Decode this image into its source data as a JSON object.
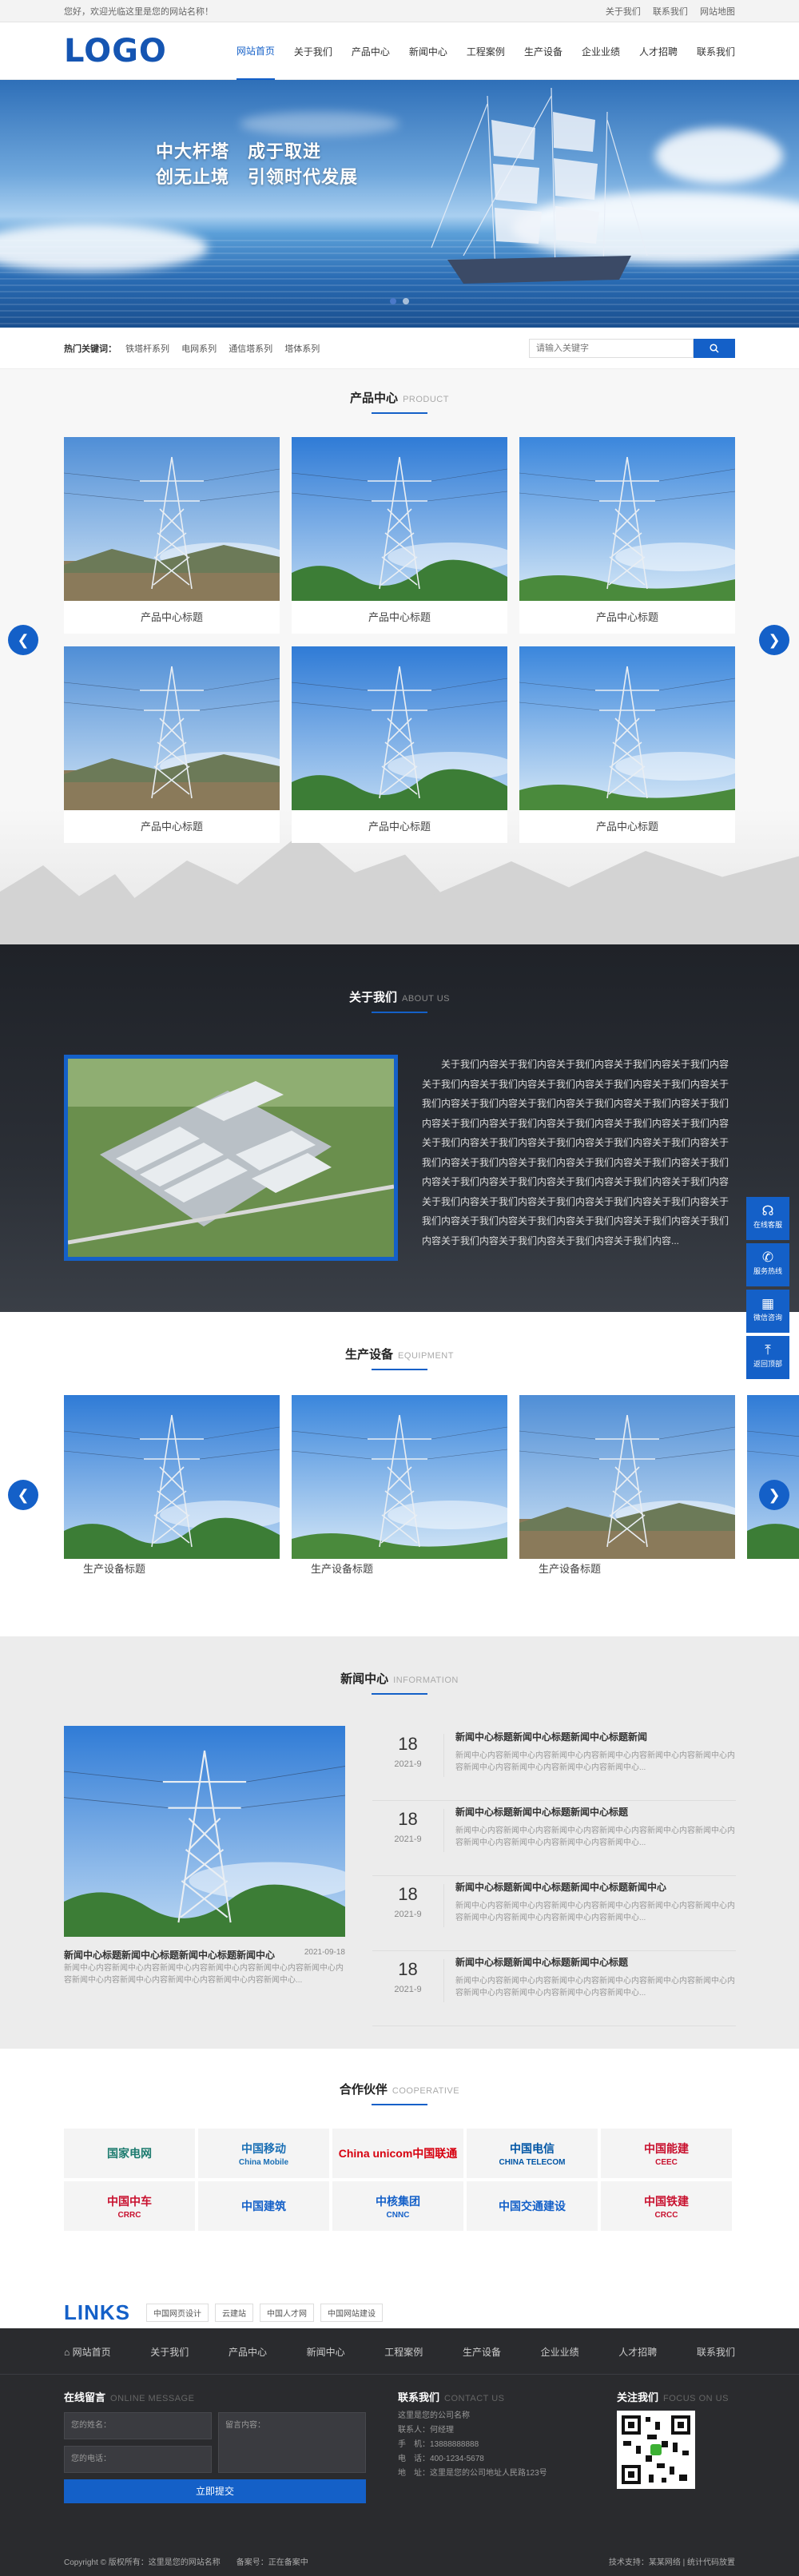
{
  "topbar": {
    "welcome": "您好，欢迎光临这里是您的网站名称！",
    "links": [
      "关于我们",
      "联系我们",
      "网站地图"
    ]
  },
  "header": {
    "logo": "LOGO",
    "nav": [
      "网站首页",
      "关于我们",
      "产品中心",
      "新闻中心",
      "工程案例",
      "生产设备",
      "企业业绩",
      "人才招聘",
      "联系我们"
    ]
  },
  "banner": {
    "line1": "中大杆塔　成于取进",
    "line2": "创无止境　引领时代发展"
  },
  "hot": {
    "label": "热门关键词：",
    "items": [
      "铁塔杆系列",
      "电网系列",
      "通信塔系列",
      "塔体系列"
    ],
    "search_placeholder": "请输入关键字"
  },
  "products": {
    "title": "产品中心",
    "title_en": "PRODUCT",
    "items": [
      "产品中心标题",
      "产品中心标题",
      "产品中心标题",
      "产品中心标题",
      "产品中心标题",
      "产品中心标题"
    ]
  },
  "about": {
    "title": "关于我们",
    "title_en": "ABOUT US",
    "text": "关于我们内容关于我们内容关于我们内容关于我们内容关于我们内容关于我们内容关于我们内容关于我们内容关于我们内容关于我们内容关于我们内容关于我们内容关于我们内容关于我们内容关于我们内容关于我们内容关于我们内容关于我们内容关于我们内容关于我们内容关于我们内容关于我们内容关于我们内容关于我们内容关于我们内容关于我们内容关于我们内容关于我们内容关于我们内容关于我们内容关于我们内容关于我们内容关于我们内容关于我们内容关于我们内容关于我们内容关于我们内容关于我们内容关于我们内容关于我们内容关于我们内容关于我们内容关于我们内容关于我们内容关于我们内容关于我们内容关于我们内容关于我们内容关于我们内容关于我们内容关于我们内容关于我们内容..."
  },
  "equipment": {
    "title": "生产设备",
    "title_en": "EQUIPMENT",
    "items": [
      "生产设备标题",
      "生产设备标题",
      "生产设备标题",
      ""
    ]
  },
  "news": {
    "title": "新闻中心",
    "title_en": "INFORMATION",
    "main": {
      "title": "新闻中心标题新闻中心标题新闻中心标题新闻中心",
      "date": "2021-09-18",
      "desc": "新闻中心内容新闻中心内容新闻中心内容新闻中心内容新闻中心内容新闻中心内容新闻中心内容新闻中心内容新闻中心内容新闻中心内容新闻中心..."
    },
    "items": [
      {
        "day": "18",
        "ym": "2021-9",
        "title": "新闻中心标题新闻中心标题新闻中心标题新闻",
        "desc": "新闻中心内容新闻中心内容新闻中心内容新闻中心内容新闻中心内容新闻中心内容新闻中心内容新闻中心内容新闻中心内容新闻中心..."
      },
      {
        "day": "18",
        "ym": "2021-9",
        "title": "新闻中心标题新闻中心标题新闻中心标题",
        "desc": "新闻中心内容新闻中心内容新闻中心内容新闻中心内容新闻中心内容新闻中心内容新闻中心内容新闻中心内容新闻中心内容新闻中心..."
      },
      {
        "day": "18",
        "ym": "2021-9",
        "title": "新闻中心标题新闻中心标题新闻中心标题新闻中心",
        "desc": "新闻中心内容新闻中心内容新闻中心内容新闻中心内容新闻中心内容新闻中心内容新闻中心内容新闻中心内容新闻中心内容新闻中心..."
      },
      {
        "day": "18",
        "ym": "2021-9",
        "title": "新闻中心标题新闻中心标题新闻中心标题",
        "desc": "新闻中心内容新闻中心内容新闻中心内容新闻中心内容新闻中心内容新闻中心内容新闻中心内容新闻中心内容新闻中心内容新闻中心..."
      }
    ]
  },
  "partners": {
    "title": "合作伙伴",
    "title_en": "COOPERATIVE",
    "logos": [
      {
        "name": "国家电网",
        "color": "#1b7a6e"
      },
      {
        "name": "中国移动",
        "sub": "China Mobile",
        "color": "#1a6fb5"
      },
      {
        "name": "China unicom中国联通",
        "color": "#d7000f"
      },
      {
        "name": "中国电信",
        "sub": "CHINA TELECOM",
        "color": "#0055a5"
      },
      {
        "name": "中国能建",
        "sub": "CEEC",
        "color": "#c8102e"
      },
      {
        "name": "中国中车",
        "sub": "CRRC",
        "color": "#c8102e"
      },
      {
        "name": "中国建筑",
        "color": "#1460c8"
      },
      {
        "name": "中核集团",
        "sub": "CNNC",
        "color": "#1460c8"
      },
      {
        "name": "中国交通建设",
        "color": "#1460c8"
      },
      {
        "name": "中国铁建",
        "sub": "CRCC",
        "color": "#c8102e"
      }
    ]
  },
  "links": {
    "title": "LINKS",
    "items": [
      "中国网页设计",
      "云建站",
      "中国人才网",
      "中国网站建设"
    ]
  },
  "footer": {
    "nav": [
      "网站首页",
      "关于我们",
      "产品中心",
      "新闻中心",
      "工程案例",
      "生产设备",
      "企业业绩",
      "人才招聘",
      "联系我们"
    ],
    "msg_title": "在线留言",
    "msg_title_en": "ONLINE MESSAGE",
    "name_ph": "您的姓名：",
    "phone_ph": "您的电话：",
    "content_ph": "留言内容：",
    "submit": "立即提交",
    "contact_title": "联系我们",
    "contact_title_en": "CONTACT US",
    "contact": [
      "这里是您的公司名称",
      "联系人：何经理",
      "手　机：13888888888",
      "电　话：400-1234-5678",
      "地　址：这里是您的公司地址人民路123号"
    ],
    "follow_title": "关注我们",
    "follow_title_en": "FOCUS ON US",
    "copyright": "Copyright © 版权所有：这里是您的网站名称　　备案号：正在备案中",
    "right": "技术支持：某某网络 | 统计代码放置"
  },
  "float": [
    "在线客服",
    "服务热线",
    "微信咨询",
    "返回顶部"
  ],
  "colors": {
    "accent": "#1460c8",
    "dark": "#2a2b2e"
  }
}
